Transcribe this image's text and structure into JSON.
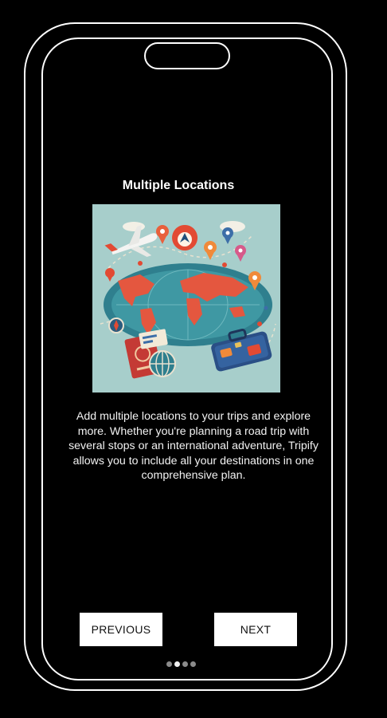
{
  "screen": {
    "title": "Multiple Locations",
    "description": "Add multiple locations to your trips and explore more. Whether you're planning a road trip with several stops or an international adventure, Tripify allows you to include all your destinations in one comprehensive plan."
  },
  "hero_image": {
    "name": "travel-map-illustration"
  },
  "buttons": {
    "previous": "PREVIOUS",
    "next": "NEXT"
  },
  "pagination": {
    "total": 4,
    "current": 2
  },
  "colors": {
    "background": "#000000",
    "text": "#ffffff",
    "button_bg": "#ffffff",
    "button_text": "#111111",
    "dot_active": "#f0f0f0",
    "dot_inactive": "#8a8a8a"
  }
}
